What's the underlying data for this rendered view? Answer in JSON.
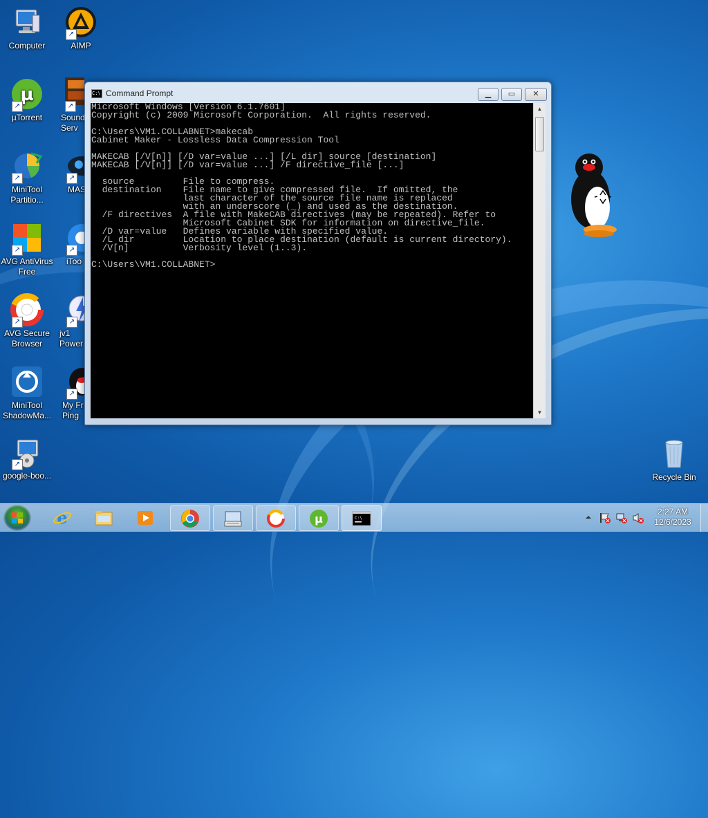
{
  "desktop": {
    "icons": [
      {
        "label": "Computer"
      },
      {
        "label": "AIMP"
      },
      {
        "label": "µTorrent"
      },
      {
        "label": "Sound Serv"
      },
      {
        "label": "MiniTool Partitio..."
      },
      {
        "label": "MAS"
      },
      {
        "label": "AVG AntiVirus Free"
      },
      {
        "label": "iToo"
      },
      {
        "label": "AVG Secure Browser"
      },
      {
        "label": "jv1 Power"
      },
      {
        "label": "MiniTool ShadowMa..."
      },
      {
        "label": "My Fr Ping"
      },
      {
        "label": "google-boo..."
      },
      {
        "label": "Recycle Bin"
      }
    ]
  },
  "cmd": {
    "title": "Command Prompt",
    "icon_text": "C:\\",
    "lines": [
      "Microsoft Windows [Version 6.1.7601]",
      "Copyright (c) 2009 Microsoft Corporation.  All rights reserved.",
      "",
      "C:\\Users\\VM1.COLLABNET>makecab",
      "Cabinet Maker - Lossless Data Compression Tool",
      "",
      "MAKECAB [/V[n]] [/D var=value ...] [/L dir] source [destination]",
      "MAKECAB [/V[n]] [/D var=value ...] /F directive_file [...]",
      "",
      "  source         File to compress.",
      "  destination    File name to give compressed file.  If omitted, the",
      "                 last character of the source file name is replaced",
      "                 with an underscore (_) and used as the destination.",
      "  /F directives  A file with MakeCAB directives (may be repeated). Refer to",
      "                 Microsoft Cabinet SDK for information on directive_file.",
      "  /D var=value   Defines variable with specified value.",
      "  /L dir         Location to place destination (default is current directory).",
      "  /V[n]          Verbosity level (1..3).",
      "",
      "C:\\Users\\VM1.COLLABNET>"
    ]
  },
  "taskbar": {
    "time": "2:27 AM",
    "date": "12/6/2023"
  }
}
